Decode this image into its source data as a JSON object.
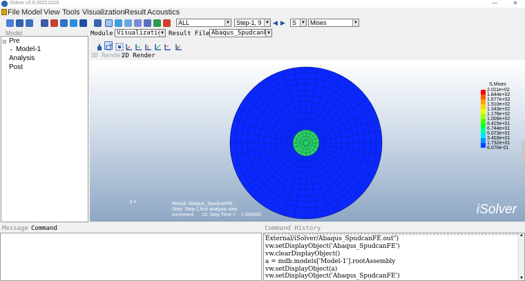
{
  "window": {
    "title": "iSolver v2.0.2022.0118",
    "minimize": "—",
    "close": "✕"
  },
  "menu": {
    "items": [
      "File",
      "Model",
      "View",
      "Tools",
      "Visualization",
      "Result",
      "Acoustics"
    ]
  },
  "toolbar": {
    "filter_value": "ALL",
    "step_value": "Step-1, 9",
    "field_value": "S",
    "component_value": "Mises"
  },
  "model_panel": {
    "title": "Model",
    "tree": [
      {
        "label": "Pre",
        "glyph": "⊟"
      },
      {
        "label": "Model-1",
        "glyph": "•"
      },
      {
        "label": "Analysis",
        "glyph": ""
      },
      {
        "label": "Post",
        "glyph": ""
      }
    ]
  },
  "module_row": {
    "module_label": "Module:",
    "module_value": "Visualization",
    "result_file_label": "Result File:",
    "result_file_value": "Abaqus_SpudcanFE"
  },
  "render_tabs": {
    "tab_3d": "3D Render",
    "tab_2d": "2D Render"
  },
  "viewport": {
    "info": [
      "Result: Abaqus_SpudcanFE",
      "Step: Step-1,first analysis step",
      "Increment      10: Step Time =    1.000000"
    ],
    "brand": "iSolver",
    "triad": "y x"
  },
  "legend": {
    "title": "S,Mises",
    "values": [
      "2.011e+02",
      "1.844e+02",
      "1.677e+02",
      "1.510e+02",
      "1.343e+02",
      "1.176e+02",
      "1.009e+02",
      "8.415e+01",
      "6.744e+01",
      "5.073e+01",
      "3.403e+01",
      "1.732e+01",
      "6.070e-01"
    ],
    "colors": [
      "#ff0000",
      "#ff5a00",
      "#ffa000",
      "#ffd200",
      "#e6ff00",
      "#a0ff00",
      "#50ff00",
      "#00ff3c",
      "#00ffa0",
      "#00e6ff",
      "#0096ff",
      "#0046ff",
      "#0000ff"
    ]
  },
  "mesh_colors": {
    "outer": "#0a28ff",
    "inner": "#2bd16a",
    "center": "#1fe06a"
  },
  "bottom": {
    "message_tab": "Message",
    "command_tab": "Command",
    "history_title": "Command History",
    "history": [
      "External/iSolver/Abaqus_SpudcanFE.out\")",
      "vw.setDisplayObject('Abaqus_SpudcanFE')",
      "vw.clearDisplayObject()",
      "a = mdb.models['Model-1'].rootAssembly",
      "vw.setDisplayObject(a)",
      "vw.setDisplayObject('Abaqus_SpudcanFE')"
    ]
  }
}
